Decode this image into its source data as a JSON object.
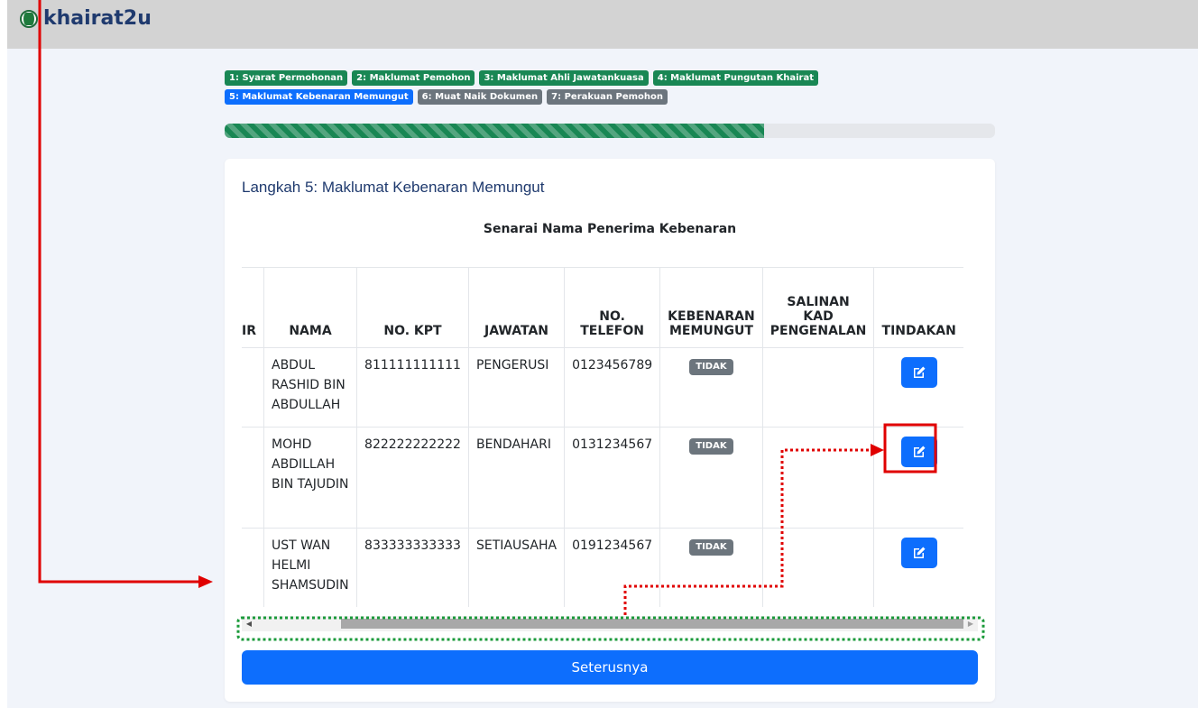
{
  "app": {
    "name": "khairat2u"
  },
  "steps": [
    {
      "label": "1: Syarat Permohonan",
      "state": "done"
    },
    {
      "label": "2: Maklumat Pemohon",
      "state": "done"
    },
    {
      "label": "3: Maklumat Ahli Jawatankuasa",
      "state": "done"
    },
    {
      "label": "4: Maklumat Pungutan Khairat",
      "state": "done"
    },
    {
      "label": "5: Maklumat Kebenaran Memungut",
      "state": "active"
    },
    {
      "label": "6: Muat Naik Dokumen",
      "state": "todo"
    },
    {
      "label": "7: Perakuan Pemohon",
      "state": "todo"
    }
  ],
  "progress": {
    "fraction": 0.7
  },
  "card": {
    "title": "Langkah 5: Maklumat Kebenaran Memungut",
    "table_caption": "Senarai Nama Penerima Kebenaran"
  },
  "table": {
    "headers": [
      "ΙR",
      "NAMA",
      "NO. KPT",
      "JAWATAN",
      "NO. TELEFON",
      "KEBENARAN MEMUNGUT",
      "SALINAN KAD PENGENALAN",
      "TINDAKAN"
    ],
    "rows": [
      {
        "nama": "ABDUL RASHID BIN ABDULLAH",
        "kpt": "811111111111",
        "jawatan": "PENGERUSI",
        "telefon": "0123456789",
        "kebenaran": "TIDAK",
        "salinan": ""
      },
      {
        "nama": "MOHD ABDILLAH BIN TAJUDIN",
        "kpt": "822222222222",
        "jawatan": "BENDAHARI",
        "telefon": "0131234567",
        "kebenaran": "TIDAK",
        "salinan": ""
      },
      {
        "nama": "UST WAN HELMI SHAMSUDIN",
        "kpt": "833333333333",
        "jawatan": "SETIAUSAHA",
        "telefon": "0191234567",
        "kebenaran": "TIDAK",
        "salinan": ""
      }
    ]
  },
  "actions": {
    "next_label": "Seterusnya"
  },
  "icons": {
    "brand": "malaysia-crest-icon",
    "edit": "edit-square-icon"
  },
  "colors": {
    "success": "#198754",
    "primary": "#0d6efd",
    "secondary": "#6c757d",
    "annotation_red": "#e00000",
    "annotation_green": "#1a9a3a"
  }
}
